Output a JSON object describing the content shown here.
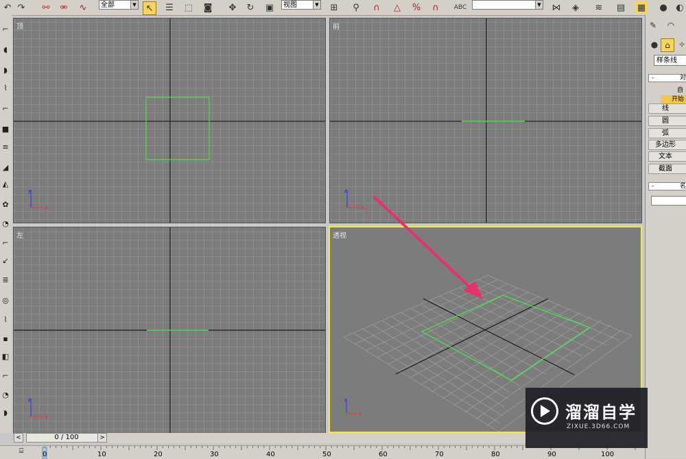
{
  "toolbar": {
    "selection_filter": "全部",
    "reference_coord": "视图"
  },
  "viewports": {
    "top": {
      "label": "顶"
    },
    "front": {
      "label": "前"
    },
    "left": {
      "label": "左"
    },
    "perspective": {
      "label": "透视"
    }
  },
  "command_panel": {
    "category": "样条线",
    "object_type_title": "对",
    "autogrid_label": "自",
    "start_new_shape": "开始",
    "buttons": [
      "线",
      "圆",
      "弧",
      "多边形",
      "文本",
      "截面"
    ],
    "name_color_title": "名"
  },
  "timeline": {
    "counter": "0 / 100",
    "prev": "<",
    "next": ">"
  },
  "ruler": {
    "ticks": [
      "0",
      "10",
      "20",
      "30",
      "40",
      "50",
      "60",
      "70",
      "80",
      "90",
      "100"
    ]
  },
  "watermark": {
    "title": "溜溜自学",
    "url": "ZIXUE.3D66.COM"
  },
  "colors": {
    "viewport_bg": "#7c7c7c",
    "grid": "#9a9a9a",
    "shape": "#4ce04c",
    "active_border": "#f5ea3a",
    "arrow": "#e8306a"
  }
}
